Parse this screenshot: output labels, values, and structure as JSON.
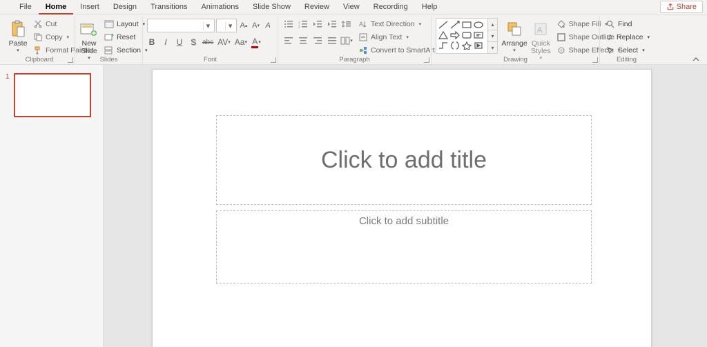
{
  "tabs": {
    "items": [
      "File",
      "Home",
      "Insert",
      "Design",
      "Transitions",
      "Animations",
      "Slide Show",
      "Review",
      "View",
      "Recording",
      "Help"
    ],
    "active": 1
  },
  "share": {
    "label": "Share"
  },
  "ribbon": {
    "clipboard": {
      "title": "Clipboard",
      "paste": "Paste",
      "cut": "Cut",
      "copy": "Copy",
      "format_painter": "Format Painter"
    },
    "slides": {
      "title": "Slides",
      "new_slide": "New\nSlide",
      "layout": "Layout",
      "reset": "Reset",
      "section": "Section"
    },
    "font": {
      "title": "Font",
      "name_placeholder": "",
      "size_placeholder": "",
      "bold": "B",
      "italic": "I",
      "underline": "U",
      "strike": "abc",
      "shadow": "S",
      "spacing": "AV",
      "case": "Aa"
    },
    "paragraph": {
      "title": "Paragraph",
      "text_direction": "Text Direction",
      "align_text": "Align Text",
      "convert_smartart": "Convert to SmartArt"
    },
    "drawing": {
      "title": "Drawing",
      "arrange": "Arrange",
      "quick_styles": "Quick\nStyles",
      "shape_fill": "Shape Fill",
      "shape_outline": "Shape Outline",
      "shape_effects": "Shape Effects"
    },
    "editing": {
      "title": "Editing",
      "find": "Find",
      "replace": "Replace",
      "select": "Select"
    }
  },
  "slide": {
    "number": "1",
    "title_placeholder": "Click to add title",
    "subtitle_placeholder": "Click to add subtitle"
  }
}
